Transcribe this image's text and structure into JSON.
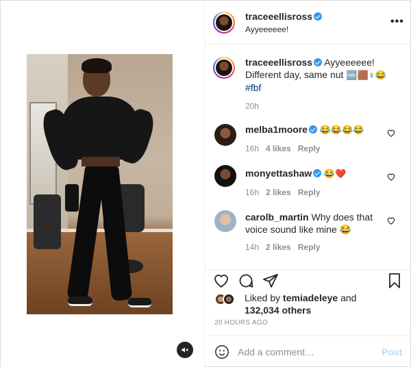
{
  "header": {
    "username": "traceeellisross",
    "subtitle": "Ayyeeeeee!",
    "more_icon": "more-dots-icon"
  },
  "caption": {
    "username": "traceeellisross",
    "text": " Ayyeeeeee! Different day, same nut ",
    "emojis": "🆒🟫♀😂",
    "hashtag": "#fbf",
    "time": "20h"
  },
  "comments": [
    {
      "username": "melba1moore",
      "verified": true,
      "text": " 😂😂😂😂",
      "time": "16h",
      "likes": "4 likes",
      "reply": "Reply"
    },
    {
      "username": "monyettashaw",
      "verified": true,
      "text": " 😂❤️",
      "time": "16h",
      "likes": "2 likes",
      "reply": "Reply"
    },
    {
      "username": "carolb_martin",
      "verified": false,
      "text": " Why does that voice sound like mine 😂",
      "time": "14h",
      "likes": "2 likes",
      "reply": "Reply"
    }
  ],
  "actions": {
    "like_icon": "heart-icon",
    "comment_icon": "comment-icon",
    "share_icon": "share-icon",
    "save_icon": "bookmark-icon"
  },
  "likes": {
    "prefix": "Liked by ",
    "user": "temiadeleye",
    "middle": " and ",
    "count": "132,034 others"
  },
  "timestamp": "20 HOURS AGO",
  "add_comment": {
    "placeholder": "Add a comment…",
    "post_label": "Post"
  },
  "colors": {
    "verified": "#3897f0",
    "post_disabled": "#b2dffc",
    "hashtag": "#00376b",
    "meta": "#8e8e8e"
  }
}
